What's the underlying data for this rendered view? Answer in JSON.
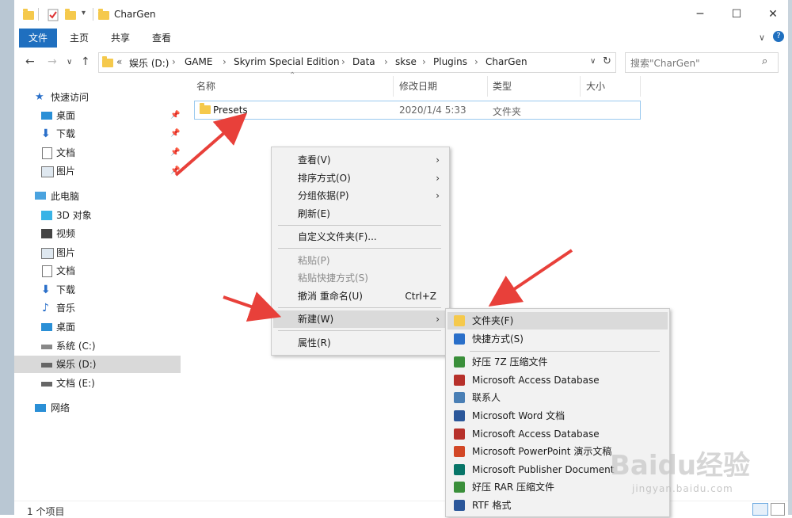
{
  "window": {
    "title": "CharGen"
  },
  "ribbon": {
    "tabs": [
      "文件",
      "主页",
      "共享",
      "查看"
    ]
  },
  "address": {
    "overflow": "«",
    "crumbs": [
      "娱乐 (D:)",
      "GAME",
      "Skyrim Special Edition",
      "Data",
      "skse",
      "Plugins",
      "CharGen"
    ],
    "separator": "›"
  },
  "search": {
    "placeholder": "搜索\"CharGen\""
  },
  "nav": {
    "quick_access": "快速访问",
    "quick_items": [
      "桌面",
      "下载",
      "文档",
      "图片"
    ],
    "this_pc": "此电脑",
    "pc_items": [
      "3D 对象",
      "视频",
      "图片",
      "文档",
      "下载",
      "音乐",
      "桌面",
      "系统 (C:)",
      "娱乐 (D:)",
      "文档 (E:)"
    ],
    "network": "网络"
  },
  "columns": {
    "name": "名称",
    "modified": "修改日期",
    "type": "类型",
    "size": "大小"
  },
  "files": [
    {
      "name": "Presets",
      "modified": "2020/1/4 5:33",
      "type": "文件夹"
    }
  ],
  "status": {
    "count": "1 个项目"
  },
  "context_menu": {
    "view": "查看(V)",
    "sort": "排序方式(O)",
    "group": "分组依据(P)",
    "refresh": "刷新(E)",
    "customize": "自定义文件夹(F)...",
    "paste": "粘贴(P)",
    "paste_shortcut": "粘贴快捷方式(S)",
    "undo": "撤消 重命名(U)",
    "undo_shortcut": "Ctrl+Z",
    "new": "新建(W)",
    "properties": "属性(R)"
  },
  "new_submenu": [
    {
      "label": "文件夹(F)",
      "icon": "folder-icon",
      "color": "#f5c94c"
    },
    {
      "label": "快捷方式(S)",
      "icon": "shortcut-icon",
      "color": "#2a6fc9"
    },
    {
      "label": "好压 7Z 压缩文件",
      "icon": "archive-icon",
      "color": "#3a8f3a"
    },
    {
      "label": "Microsoft Access Database",
      "icon": "access-icon",
      "color": "#b7312b"
    },
    {
      "label": "联系人",
      "icon": "contact-icon",
      "color": "#4a7fb5"
    },
    {
      "label": "Microsoft Word 文档",
      "icon": "word-icon",
      "color": "#2b579a"
    },
    {
      "label": "Microsoft Access Database",
      "icon": "access-icon",
      "color": "#b7312b"
    },
    {
      "label": "Microsoft PowerPoint 演示文稿",
      "icon": "powerpoint-icon",
      "color": "#d24726"
    },
    {
      "label": "Microsoft Publisher Document",
      "icon": "publisher-icon",
      "color": "#077568"
    },
    {
      "label": "好压 RAR 压缩文件",
      "icon": "archive-icon",
      "color": "#3a8f3a"
    },
    {
      "label": "RTF 格式",
      "icon": "rtf-icon",
      "color": "#2b579a"
    }
  ],
  "watermark": {
    "brand": "Baidu经验",
    "url": "jingyan.baidu.com"
  },
  "colors": {
    "accent": "#1f6fbf",
    "arrow": "#e8403a",
    "selection_border": "#99c9ef"
  }
}
